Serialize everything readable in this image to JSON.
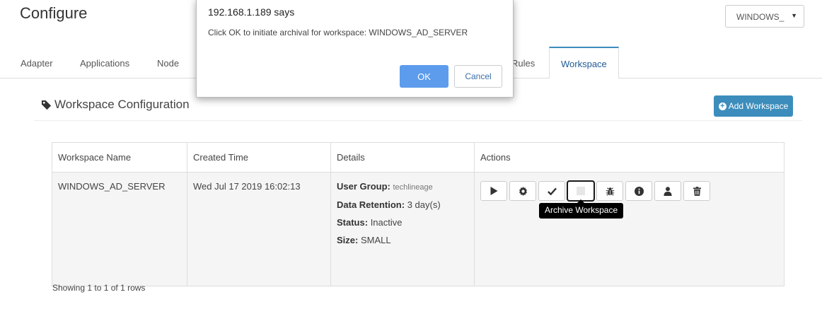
{
  "page": {
    "title": "Configure",
    "workspace_select": {
      "value": "WINDOWS_"
    }
  },
  "tabs": [
    {
      "label": "Adapter"
    },
    {
      "label": "Applications"
    },
    {
      "label": "Node"
    },
    {
      "label": "Rules"
    },
    {
      "label": "Workspace",
      "active": true
    }
  ],
  "section": {
    "title": "Workspace Configuration",
    "add_button_label": "Add Workspace"
  },
  "table": {
    "columns": [
      "Workspace Name",
      "Created Time",
      "Details",
      "Actions"
    ],
    "rows": [
      {
        "name": "WINDOWS_AD_SERVER",
        "created": "Wed Jul 17 2019 16:02:13",
        "details": [
          {
            "key": "User Group:",
            "value": "techlineage"
          },
          {
            "key": "Data Retention:",
            "value": "3 day(s)"
          },
          {
            "key": "Status:",
            "value": "Inactive"
          },
          {
            "key": "Size:",
            "value": "SMALL"
          }
        ]
      }
    ],
    "actions": [
      {
        "icon": "play-icon"
      },
      {
        "icon": "gear-icon"
      },
      {
        "icon": "check-icon"
      },
      {
        "icon": "archive-icon",
        "focused": true
      },
      {
        "icon": "bug-icon"
      },
      {
        "icon": "info-icon"
      },
      {
        "icon": "user-icon"
      },
      {
        "icon": "trash-icon"
      }
    ]
  },
  "tooltip": {
    "text": "Archive Workspace"
  },
  "footer": {
    "pagination_text": "Showing 1 to 1 of 1 rows"
  },
  "dialog": {
    "origin": "192.168.1.189 says",
    "message": "Click OK to initiate archival for workspace: WINDOWS_AD_SERVER",
    "ok_label": "OK",
    "cancel_label": "Cancel"
  },
  "colors": {
    "primary": "#3c8dbc",
    "dialog_ok": "#5d9cec",
    "active_tab_text": "#1f5a96"
  }
}
